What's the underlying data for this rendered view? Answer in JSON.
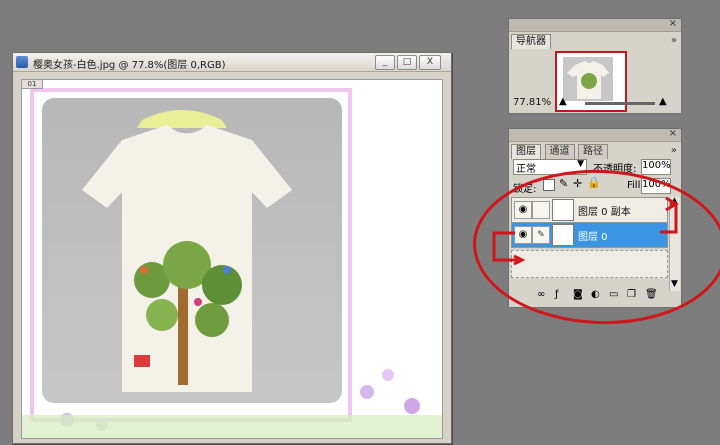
{
  "document_window": {
    "title": "樱奥女孩-白色.jpg @ 77.8%(图层 0,RGB)",
    "ruler_label": "01",
    "buttons": {
      "minimize": "_",
      "maximize": "□",
      "close": "X"
    }
  },
  "navigator_panel": {
    "tabs": [
      {
        "label": "导航器"
      }
    ],
    "zoom": "77.81%",
    "menu_icon": "panel-menu-icon"
  },
  "layers_panel": {
    "tabs": [
      {
        "label": "图层"
      },
      {
        "label": "通道"
      },
      {
        "label": "路径"
      }
    ],
    "blend_mode": "正常",
    "opacity_label": "不透明度:",
    "opacity_value": "100%",
    "lock_label": "锁定:",
    "fill_label": "Fill:",
    "fill_value": "100%",
    "layers": [
      {
        "name": "图层 0 副本",
        "selected": false
      },
      {
        "name": "图层 0",
        "selected": true
      }
    ]
  },
  "colors": {
    "annotation_red": "#d0161b",
    "selection_blue": "#3b95e3",
    "workspace_gray": "#7d7d7d"
  }
}
